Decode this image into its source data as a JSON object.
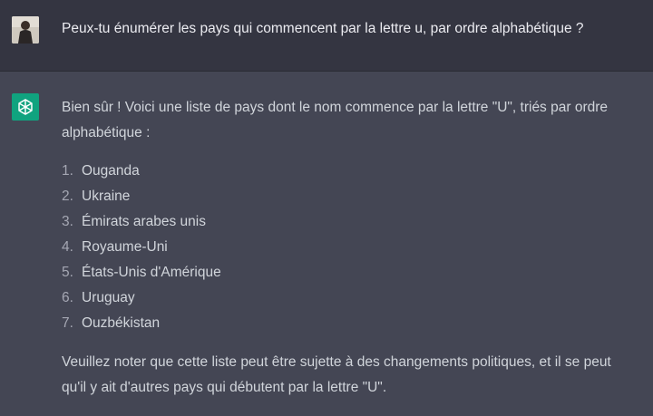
{
  "user_message": {
    "text": "Peux-tu énumérer les pays qui commencent par la lettre u, par ordre alphabétique ?"
  },
  "assistant_message": {
    "intro": "Bien sûr ! Voici une liste de pays dont le nom commence par la lettre \"U\", triés par ordre alphabétique :",
    "items": [
      {
        "num": "1.",
        "text": "Ouganda"
      },
      {
        "num": "2.",
        "text": "Ukraine"
      },
      {
        "num": "3.",
        "text": "Émirats arabes unis"
      },
      {
        "num": "4.",
        "text": "Royaume-Uni"
      },
      {
        "num": "5.",
        "text": "États-Unis d'Amérique"
      },
      {
        "num": "6.",
        "text": "Uruguay"
      },
      {
        "num": "7.",
        "text": "Ouzbékistan"
      }
    ],
    "outro": "Veuillez noter que cette liste peut être sujette à des changements politiques, et il se peut qu'il y ait d'autres pays qui débutent par la lettre \"U\"."
  },
  "colors": {
    "user_bg": "#343541",
    "assistant_bg": "#444654",
    "accent": "#10a37f",
    "text": "#d1d5db"
  },
  "icons": {
    "user_avatar": "user-avatar-photo",
    "assistant_avatar": "openai-logo-icon"
  }
}
